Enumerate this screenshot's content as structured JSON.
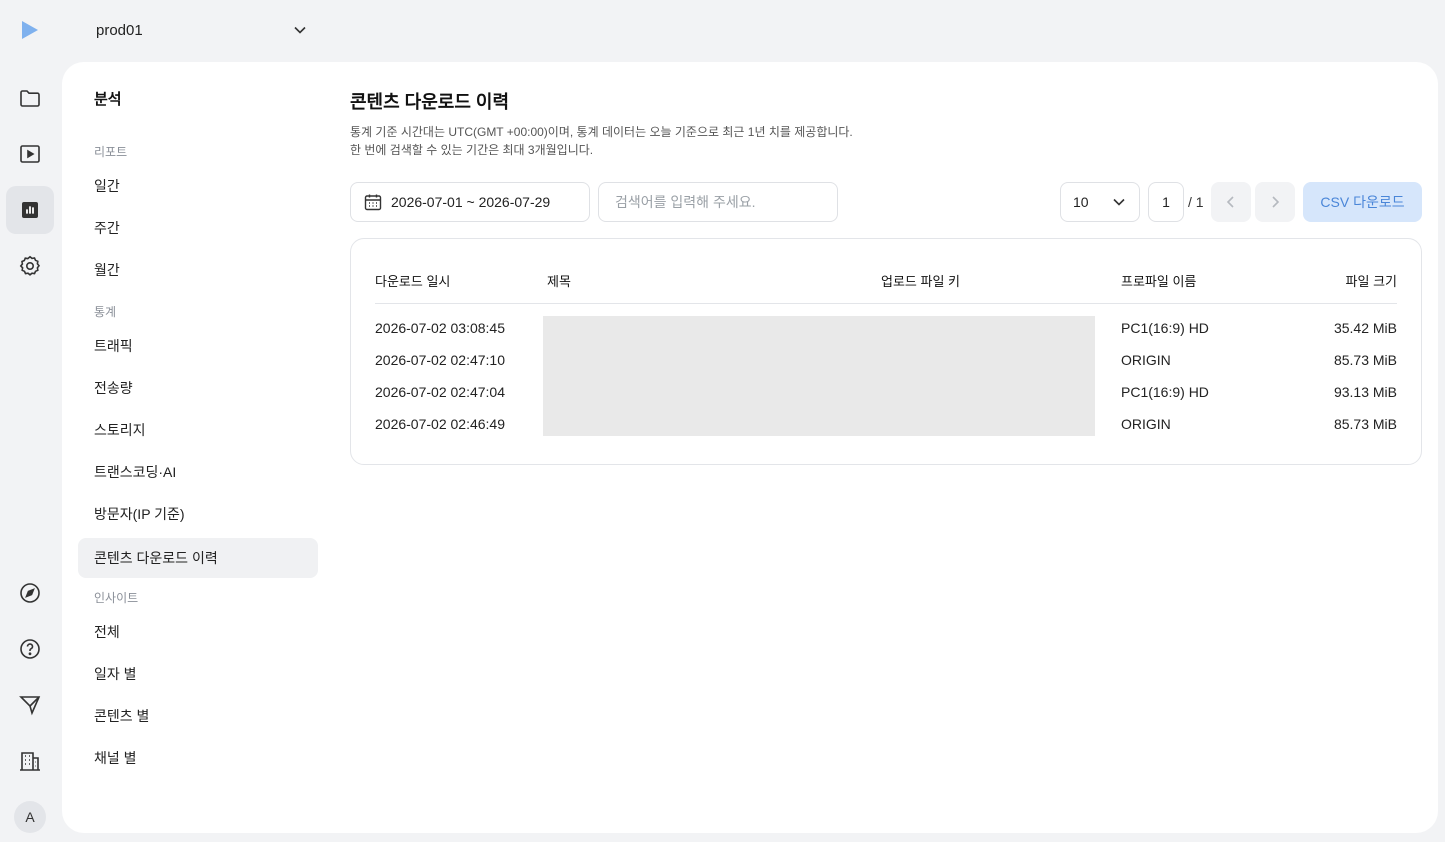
{
  "app": {
    "project_name": "prod01",
    "avatar_initial": "A",
    "accent": "#4a86d8"
  },
  "rail": {
    "top_icons": [
      "folder-icon",
      "play-icon",
      "chart-icon",
      "gear-icon"
    ],
    "bottom_icons": [
      "compass-icon",
      "help-icon",
      "send-icon",
      "building-icon"
    ],
    "active": "chart-icon"
  },
  "subnav": {
    "title": "분석",
    "groups": {
      "report": "리포트",
      "stats": "통계",
      "insight": "인사이트"
    },
    "items": {
      "daily": "일간",
      "weekly": "주간",
      "monthly": "월간",
      "traffic": "트래픽",
      "transfer": "전송량",
      "storage": "스토리지",
      "transcoding": "트랜스코딩·AI",
      "visitors": "방문자(IP 기준)",
      "downloads": "콘텐츠 다운로드 이력",
      "all": "전체",
      "by_date": "일자 별",
      "by_content": "콘텐츠 별",
      "by_channel": "채널 별"
    },
    "active": "downloads"
  },
  "page": {
    "title": "콘텐츠 다운로드 이력",
    "desc_line1": "통계 기준 시간대는 UTC(GMT +00:00)이며, 통계 데이터는 오늘 기준으로 최근 1년 치를 제공합니다.",
    "desc_line2": "한 번에 검색할 수 있는 기간은 최대 3개월입니다."
  },
  "filters": {
    "date_range": "2026-07-01 ~ 2026-07-29",
    "search_placeholder": "검색어를 입력해 주세요.",
    "search_value": "",
    "per_page": "10",
    "page": "1",
    "total_pages": "/ 1",
    "csv_label": "CSV 다운로드"
  },
  "table": {
    "headers": {
      "datetime": "다운로드 일시",
      "title": "제목",
      "key": "업로드 파일 키",
      "profile": "프로파일 이름",
      "size": "파일 크기"
    },
    "rows": [
      {
        "datetime": "2026-07-02 03:08:45",
        "profile": "PC1(16:9) HD",
        "size": "35.42 MiB"
      },
      {
        "datetime": "2026-07-02 02:47:10",
        "profile": "ORIGIN",
        "size": "85.73 MiB"
      },
      {
        "datetime": "2026-07-02 02:47:04",
        "profile": "PC1(16:9) HD",
        "size": "93.13 MiB"
      },
      {
        "datetime": "2026-07-02 02:46:49",
        "profile": "ORIGIN",
        "size": "85.73 MiB"
      }
    ]
  }
}
